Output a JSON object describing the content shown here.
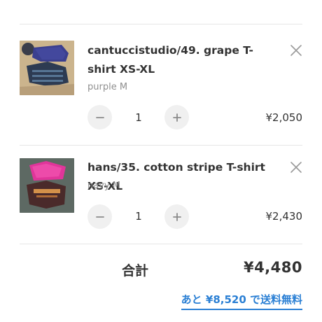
{
  "cart": {
    "items": [
      {
        "title": "cantuccistudio/49. grape T-shirt XS-XL",
        "variant": "purple M",
        "quantity": "1",
        "price": "¥2,050",
        "thumbnail": "grape-tshirt-photo"
      },
      {
        "title": "hans/35. cotton stripe T-shirt XS-XL",
        "variant": "navy M",
        "quantity": "1",
        "price": "¥2,430",
        "thumbnail": "stripe-tshirt-photo"
      }
    ],
    "total_label": "合計",
    "total_value": "¥4,480",
    "shipping_note": "あと ¥8,520 で送料無料"
  },
  "icons": {
    "remove": "close-icon",
    "decrease": "minus-icon",
    "increase": "plus-icon"
  },
  "colors": {
    "accent": "#2a7fd4",
    "stepper_bg": "#f0f0f0",
    "muted_text": "#8f8f8f"
  }
}
